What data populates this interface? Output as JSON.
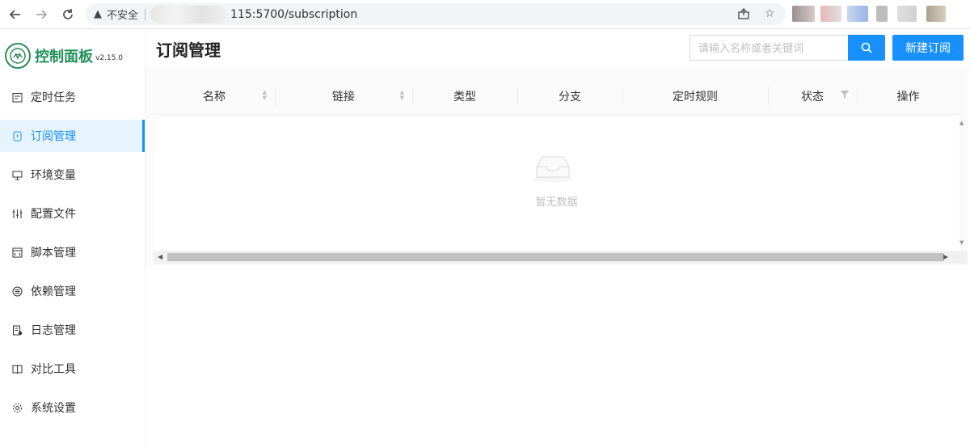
{
  "browser": {
    "security_label": "不安全",
    "url": "115:5700/subscription",
    "nav": {
      "back_icon": "back-arrow-icon",
      "forward_icon": "forward-arrow-icon",
      "reload_icon": "reload-icon"
    }
  },
  "app": {
    "title": "控制面板",
    "version": "v2.15.0"
  },
  "sidebar": {
    "items": [
      {
        "label": "定时任务",
        "icon": "calendar-icon"
      },
      {
        "label": "订阅管理",
        "icon": "subscription-icon",
        "active": true
      },
      {
        "label": "环境变量",
        "icon": "monitor-icon"
      },
      {
        "label": "配置文件",
        "icon": "sliders-icon"
      },
      {
        "label": "脚本管理",
        "icon": "code-file-icon"
      },
      {
        "label": "依赖管理",
        "icon": "database-icon"
      },
      {
        "label": "日志管理",
        "icon": "log-icon"
      },
      {
        "label": "对比工具",
        "icon": "compare-icon"
      },
      {
        "label": "系统设置",
        "icon": "gear-icon"
      }
    ]
  },
  "header": {
    "title": "订阅管理",
    "search_placeholder": "请输入名称或者关键词",
    "new_button_label": "新建订阅"
  },
  "table": {
    "columns": [
      "名称",
      "链接",
      "类型",
      "分支",
      "定时规则",
      "状态",
      "操作"
    ],
    "empty_text": "暂无数据"
  },
  "colors": {
    "primary": "#1890ff",
    "brand": "#1f8f5a"
  }
}
